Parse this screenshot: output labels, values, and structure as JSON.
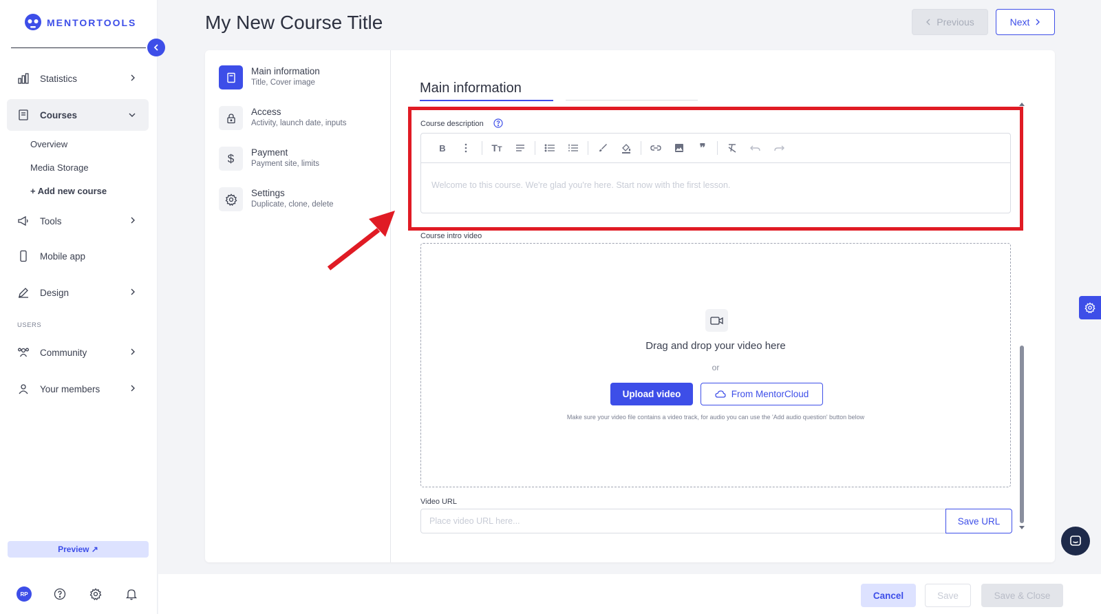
{
  "app": {
    "logo_text": "MENTORTOOLS"
  },
  "sidebar": {
    "items": [
      {
        "label": "Statistics",
        "icon": "bar-chart-icon"
      },
      {
        "label": "Courses",
        "icon": "book-icon"
      },
      {
        "label": "Tools",
        "icon": "megaphone-icon"
      },
      {
        "label": "Mobile app",
        "icon": "phone-icon"
      },
      {
        "label": "Design",
        "icon": "pencil-icon"
      },
      {
        "label": "Community",
        "icon": "people-icon"
      },
      {
        "label": "Your members",
        "icon": "user-icon"
      }
    ],
    "courses_sub": [
      "Overview",
      "Media Storage",
      "+ Add new course"
    ],
    "users_section": "USERS",
    "preview_label": "Preview ↗",
    "avatar_initials": "RP"
  },
  "header": {
    "title": "My New Course Title",
    "previous_label": "Previous",
    "next_label": "Next"
  },
  "steps": [
    {
      "title": "Main information",
      "subtitle": "Title, Cover image",
      "icon": "book-icon"
    },
    {
      "title": "Access",
      "subtitle": "Activity, launch date, inputs",
      "icon": "lock-icon"
    },
    {
      "title": "Payment",
      "subtitle": "Payment site, limits",
      "icon": "dollar-icon"
    },
    {
      "title": "Settings",
      "subtitle": "Duplicate, clone, delete",
      "icon": "gear-icon"
    }
  ],
  "main": {
    "tab_title": "Main information",
    "description_label": "Course description",
    "description_placeholder": "Welcome to this course. We're glad you're here. Start now with the first lesson.",
    "video_label": "Course intro video",
    "dropzone_title": "Drag and drop your video here",
    "dropzone_or": "or",
    "upload_label": "Upload video",
    "cloud_label": "From MentorCloud",
    "dropzone_note": "Make sure your video file contains a video track, for audio you can use the 'Add audio question' button below",
    "url_label": "Video URL",
    "url_placeholder": "Place video URL here...",
    "save_url_label": "Save URL"
  },
  "footer": {
    "cancel_label": "Cancel",
    "save_label": "Save",
    "save_close_label": "Save & Close"
  },
  "colors": {
    "accent": "#3d4ee8",
    "annotation": "#e01b24"
  }
}
